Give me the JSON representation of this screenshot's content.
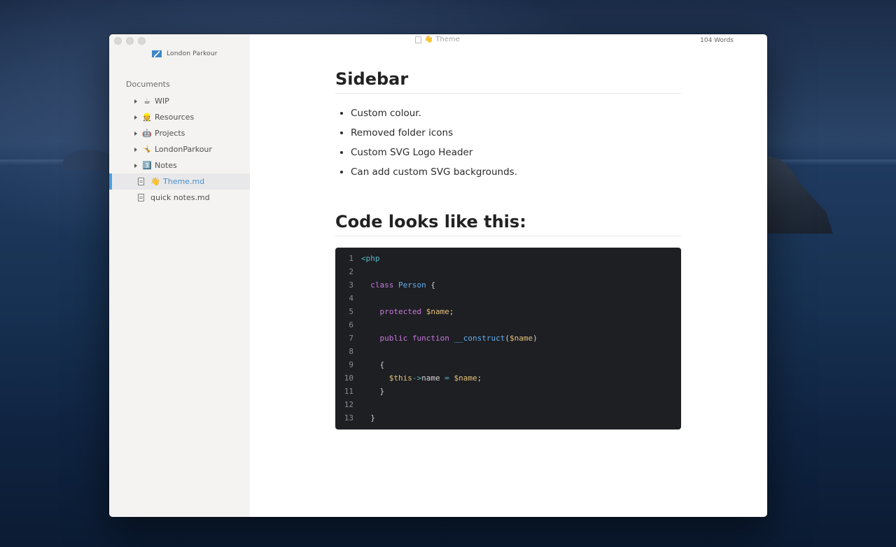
{
  "window": {
    "title": "Theme",
    "title_emoji": "👋",
    "word_count": "104 Words"
  },
  "sidebar": {
    "brand": "London Parkour",
    "section_label": "Documents",
    "folders": [
      {
        "emoji": "☕",
        "label": "WIP"
      },
      {
        "emoji": "👷",
        "label": "Resources"
      },
      {
        "emoji": "🤖",
        "label": "Projects"
      },
      {
        "emoji": "🤸",
        "label": "LondonParkour"
      },
      {
        "emoji": "3️⃣",
        "label": "Notes"
      }
    ],
    "files": [
      {
        "emoji": "👋",
        "label": "Theme.md",
        "active": true
      },
      {
        "emoji": "",
        "label": "quick notes.md",
        "active": false
      }
    ]
  },
  "document": {
    "heading1": "Sidebar",
    "bullets": [
      "Custom colour.",
      "Removed folder icons",
      "Custom SVG Logo Header",
      "Can add custom SVG backgrounds."
    ],
    "heading2": "Code looks like this:",
    "code": {
      "line_numbers": [
        "1",
        "2",
        "3",
        "4",
        "5",
        "6",
        "7",
        "8",
        "9",
        "10",
        "11",
        "12",
        "13"
      ],
      "l1": "<php",
      "l3_kw": "class",
      "l3_cls": "Person",
      "l3_end": "{",
      "l5_kw": "protected",
      "l5_var": "$name",
      "l5_end": ";",
      "l7_kw1": "public",
      "l7_kw2": "function",
      "l7_fn": "__construct",
      "l7_open": "(",
      "l7_var": "$name",
      "l7_close": ")",
      "l9": "{",
      "l10_var1": "$this",
      "l10_op1": "->",
      "l10_prop": "name",
      "l10_op2": "=",
      "l10_var2": "$name",
      "l10_end": ";",
      "l11": "}",
      "l13": "}"
    }
  },
  "colors": {
    "accent": "#4a9fe0",
    "code_bg": "#1e1f23",
    "keyword": "#c678dd",
    "class": "#61afef",
    "variable": "#e5c07b"
  }
}
